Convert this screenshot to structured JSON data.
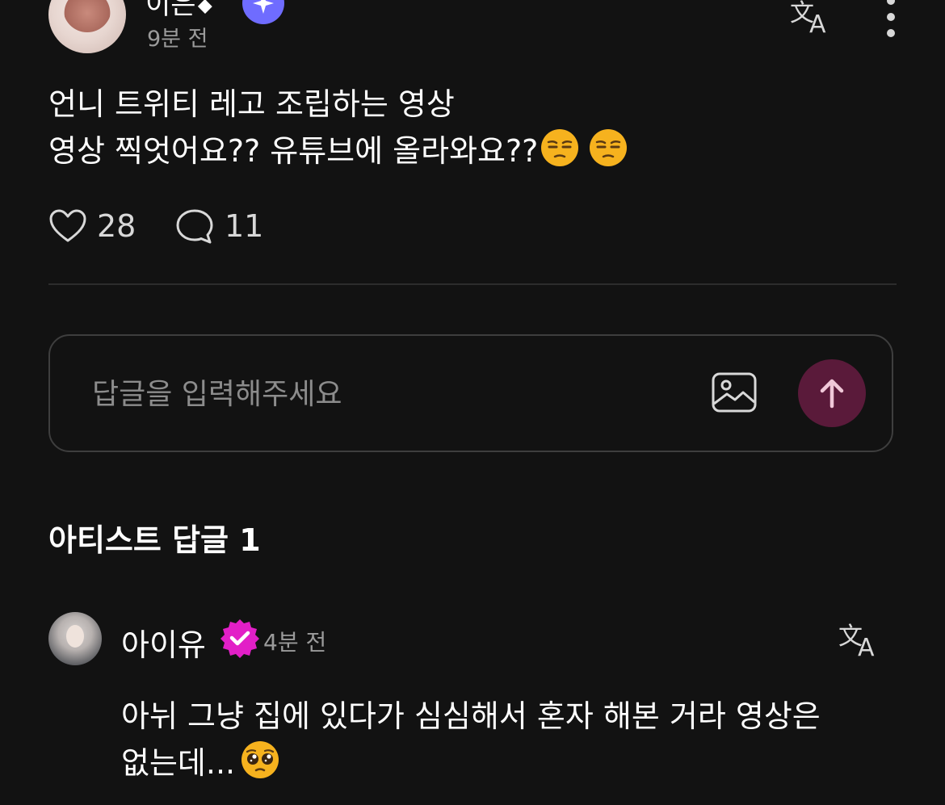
{
  "post": {
    "author": "이은ꗃ",
    "time": "9분 전",
    "body_line1": "언니 트위티 레고 조립하는 영상",
    "body_line2": "영상 찍엇어요?? 유튜브에 올라와요??",
    "emojis": [
      "unamused-face",
      "unamused-face"
    ],
    "like_count": "28",
    "comment_count": "11"
  },
  "reply_input": {
    "placeholder": "답글을 입력해주세요"
  },
  "artist_replies": {
    "title": "아티스트 답글 1",
    "items": [
      {
        "author": "아이유",
        "time": "4분 전",
        "body_line1": "아뉘 그냥 집에 있다가 심심해서 혼자 해본 거라 영상은",
        "body_line2": "없는데...",
        "emoji": "pleading-face"
      }
    ]
  },
  "colors": {
    "background": "#121212",
    "send_button": "#5a1a3a",
    "fan_badge": "#6f6cff",
    "artist_badge": "#e21fc7",
    "muted_text": "#9b9b9b"
  },
  "icons": [
    "translate-icon",
    "more-icon",
    "heart-icon",
    "comment-icon",
    "image-icon",
    "arrow-up-icon",
    "verified-badge-icon"
  ]
}
